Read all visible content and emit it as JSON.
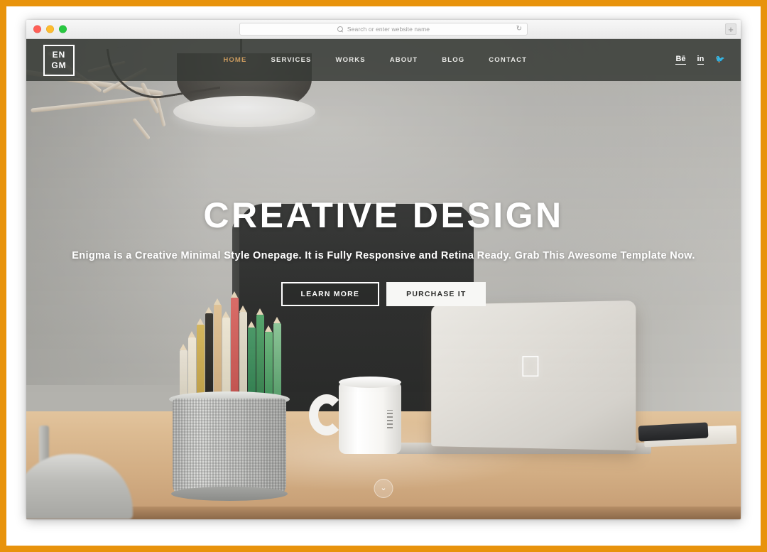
{
  "frame": {
    "border_color": "#e8930c",
    "inner_background": "#ffffff"
  },
  "browser": {
    "traffic_lights": [
      {
        "name": "close",
        "color": "#ff5f57"
      },
      {
        "name": "minimize",
        "color": "#febc2e"
      },
      {
        "name": "zoom",
        "color": "#28c840"
      }
    ],
    "address_bar": {
      "value": "",
      "placeholder": "Search or enter website name",
      "search_icon": "search-icon",
      "reload_icon": "reload-icon",
      "reload_glyph": "↻"
    },
    "new_tab_button": {
      "label": "+",
      "icon": "plus-icon"
    }
  },
  "site": {
    "header": {
      "logo": {
        "line1": "EN",
        "line2": "GM",
        "alt": "Enigma logo"
      },
      "nav": [
        {
          "label": "HOME",
          "active": true
        },
        {
          "label": "SERVICES",
          "active": false
        },
        {
          "label": "WORKS",
          "active": false
        },
        {
          "label": "ABOUT",
          "active": false
        },
        {
          "label": "BLOG",
          "active": false
        },
        {
          "label": "CONTACT",
          "active": false
        }
      ],
      "active_color": "#c99a5e",
      "background": "rgba(56,59,55,0.86)",
      "social": [
        {
          "name": "behance-icon",
          "glyph": "Bē"
        },
        {
          "name": "linkedin-icon",
          "glyph": "in"
        },
        {
          "name": "twitter-icon",
          "glyph": "🐦"
        }
      ]
    },
    "hero": {
      "title": "CREATIVE DESIGN",
      "subtitle": "Enigma is a Creative Minimal Style Onepage. It is Fully Responsive and Retina Ready. Grab This Awesome Template Now.",
      "primary_button": "LEARN MORE",
      "secondary_button": "PURCHASE IT",
      "scroll_indicator": "⌄"
    }
  }
}
